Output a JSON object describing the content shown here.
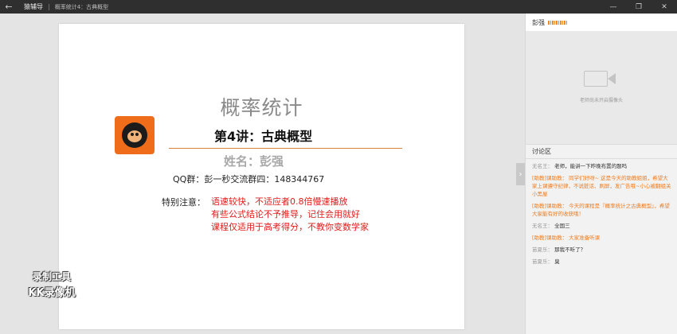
{
  "titlebar": {
    "back_icon": "arrow-left-icon",
    "app_name": "猿辅导",
    "course": "概率统计4：古典概型",
    "controls": [
      "minimize-icon",
      "restore-icon",
      "close-icon"
    ]
  },
  "slide": {
    "title": "概率统计",
    "lecture": "第4讲：古典概型",
    "name": "姓名：彭强",
    "qq": "QQ群：彭一秒交流群四：148344767",
    "note_label": "特别注意：",
    "note_lines": [
      "语速较快，不适应者0.8倍慢速播放",
      "有些公式结论不予推导，记住会用就好",
      "课程仅适用于高考得分，不教你变数学家"
    ],
    "accent_color": "#e21b1b",
    "logo_color": "#ef6c1a"
  },
  "watermark": {
    "line1": "录制工具",
    "line2": "KK录像机"
  },
  "panel": {
    "teacher_name": "彭强",
    "video_message": "老师尚未开启摄像头",
    "discussion_title": "讨论区",
    "messages": [
      {
        "who": "无名王：",
        "text": "老师，能讲一下昨晚布置的题吗",
        "staff": false
      },
      {
        "who": "[助教]课助教：",
        "text": "同学们好呀~ 这是今天的助教姐姐，希望大家上课遵守纪律，不说脏话、刷屏，发广告哦~小心被翻组关小黑屋",
        "staff": true
      },
      {
        "who": "[助教]课助教：",
        "text": "今天的课程是『概率统计之古典概型』，希望大家能有好的收获哦！",
        "staff": true
      },
      {
        "who": "无名王：",
        "text": "全国三",
        "staff": false
      },
      {
        "who": "[助教]课助教：",
        "text": "大家准备听课",
        "staff": true
      },
      {
        "who": "苗夏乐：",
        "text": "那我不听了？",
        "staff": false
      },
      {
        "who": "苗夏乐：",
        "text": "臭",
        "staff": false
      }
    ]
  }
}
